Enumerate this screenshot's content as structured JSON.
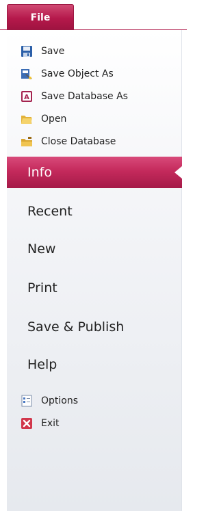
{
  "file_tab": {
    "label": "File"
  },
  "commands": [
    {
      "label": "Save",
      "icon": "save-icon"
    },
    {
      "label": "Save Object As",
      "icon": "save-object-as-icon"
    },
    {
      "label": "Save Database As",
      "icon": "save-database-as-icon"
    },
    {
      "label": "Open",
      "icon": "open-folder-icon"
    },
    {
      "label": "Close Database",
      "icon": "close-database-icon"
    }
  ],
  "nav": [
    {
      "label": "Info",
      "selected": true
    },
    {
      "label": "Recent",
      "selected": false
    },
    {
      "label": "New",
      "selected": false
    },
    {
      "label": "Print",
      "selected": false
    },
    {
      "label": "Save & Publish",
      "selected": false
    },
    {
      "label": "Help",
      "selected": false
    }
  ],
  "footer_commands": [
    {
      "label": "Options",
      "icon": "options-icon"
    },
    {
      "label": "Exit",
      "icon": "exit-icon"
    }
  ],
  "colors": {
    "accent": "#b5194b",
    "selected_text": "#ffffff",
    "text": "#222222"
  }
}
